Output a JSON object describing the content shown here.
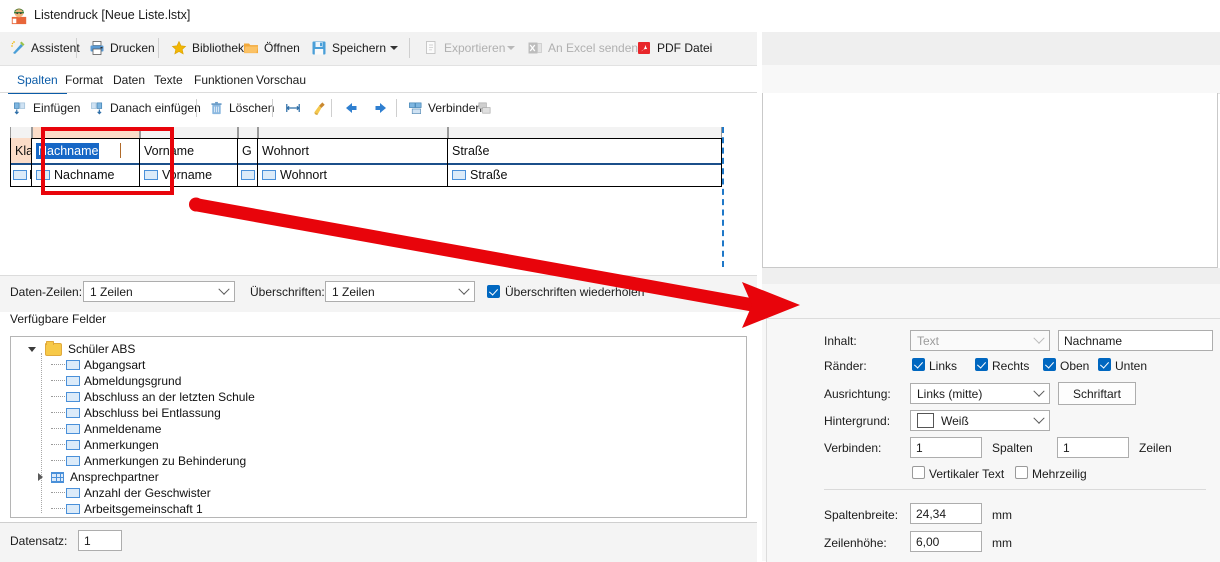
{
  "window": {
    "title": "Listendruck [Neue Liste.lstx]",
    "icon": "app-icon",
    "minimize": "minimize",
    "maximize": "maximize",
    "close": "close"
  },
  "toolbar": {
    "items": [
      {
        "label": "Assistent",
        "icon": "wand-icon",
        "enabled": true
      },
      {
        "label": "Drucken",
        "icon": "printer-icon",
        "enabled": true
      },
      {
        "label": "Bibliothek",
        "icon": "star-icon",
        "enabled": true
      },
      {
        "label": "Öffnen",
        "icon": "folder-open-icon",
        "enabled": true
      },
      {
        "label": "Speichern",
        "icon": "floppy-disk-icon",
        "enabled": true
      },
      {
        "label": "Exportieren",
        "icon": "export-icon",
        "enabled": false
      },
      {
        "label": "An Excel senden",
        "icon": "excel-icon",
        "enabled": false
      },
      {
        "label": "PDF Datei",
        "icon": "pdf-icon",
        "enabled": true
      }
    ]
  },
  "tabs": {
    "items": [
      "Spalten",
      "Format",
      "Daten",
      "Texte",
      "Funktionen",
      "Vorschau"
    ],
    "selected": "Spalten"
  },
  "subtoolbar": {
    "items": [
      {
        "label": "Einfügen",
        "icon": "insert-column-icon"
      },
      {
        "label": "Danach einfügen",
        "icon": "insert-column-after-icon"
      },
      {
        "label": "Löschen",
        "icon": "trash-icon"
      },
      {
        "label": "",
        "icon": "fit-width-icon"
      },
      {
        "label": "",
        "icon": "broom-icon"
      },
      {
        "label": "",
        "icon": "arrow-left-icon"
      },
      {
        "label": "",
        "icon": "arrow-right-icon"
      },
      {
        "label": "Verbinden",
        "icon": "merge-cells-icon"
      },
      {
        "label": "",
        "icon": "split-cells-icon"
      }
    ]
  },
  "grid": {
    "header_row": [
      {
        "text": "Kla...",
        "selected": false
      },
      {
        "text": "Nachname",
        "selected": true
      },
      {
        "text": "Vorname",
        "selected": false
      },
      {
        "text": "G",
        "selected": false
      },
      {
        "text": "Wohnort",
        "selected": false
      },
      {
        "text": "Straße",
        "selected": false
      }
    ],
    "data_row": [
      {
        "text": "K.",
        "chip": true
      },
      {
        "text": "Nachname",
        "chip": true
      },
      {
        "text": "Vorname",
        "chip": true
      },
      {
        "text": "",
        "chip": true
      },
      {
        "text": "Wohnort",
        "chip": true
      },
      {
        "text": "Straße",
        "chip": true
      }
    ]
  },
  "options": {
    "data_rows_label": "Daten-Zeilen:",
    "data_rows_value": "1 Zeilen",
    "headings_label": "Überschriften:",
    "headings_value": "1 Zeilen",
    "repeat_headings_label": "Überschriften wiederholen",
    "repeat_headings_checked": true
  },
  "fields": {
    "label": "Verfügbare Felder",
    "tree": [
      {
        "label": "Schüler ABS",
        "level": 0,
        "icon": "folder-icon",
        "expander": "open"
      },
      {
        "label": "Abgangsart",
        "level": 1,
        "icon": "field-icon",
        "expander": "none"
      },
      {
        "label": "Abmeldungsgrund",
        "level": 1,
        "icon": "field-icon",
        "expander": "none"
      },
      {
        "label": "Abschluss an der letzten Schule",
        "level": 1,
        "icon": "field-icon",
        "expander": "none"
      },
      {
        "label": "Abschluss bei Entlassung",
        "level": 1,
        "icon": "field-icon",
        "expander": "none"
      },
      {
        "label": "Anmeldename",
        "level": 1,
        "icon": "field-icon",
        "expander": "none"
      },
      {
        "label": "Anmerkungen",
        "level": 1,
        "icon": "field-icon",
        "expander": "none"
      },
      {
        "label": "Anmerkungen zu Behinderung",
        "level": 1,
        "icon": "field-icon",
        "expander": "none"
      },
      {
        "label": "Ansprechpartner",
        "level": 1,
        "icon": "table-icon",
        "expander": "closed"
      },
      {
        "label": "Anzahl der Geschwister",
        "level": 1,
        "icon": "field-icon",
        "expander": "none"
      },
      {
        "label": "Arbeitsgemeinschaft 1",
        "level": 1,
        "icon": "field-icon",
        "expander": "none"
      }
    ]
  },
  "record": {
    "label": "Datensatz:",
    "value": "1"
  },
  "properties": {
    "content_label": "Inhalt:",
    "content_type": "Text",
    "content_value": "Nachname",
    "borders_label": "Ränder:",
    "borders": [
      {
        "label": "Links",
        "checked": true
      },
      {
        "label": "Rechts",
        "checked": true
      },
      {
        "label": "Oben",
        "checked": true
      },
      {
        "label": "Unten",
        "checked": true
      }
    ],
    "alignment_label": "Ausrichtung:",
    "alignment_value": "Links (mitte)",
    "font_button": "Schriftart",
    "background_label": "Hintergrund:",
    "background_value": "Weiß",
    "background_color": "#ffffff",
    "merge_label": "Verbinden:",
    "merge_cols_value": "1",
    "merge_cols_unit": "Spalten",
    "merge_rows_value": "1",
    "merge_rows_unit": "Zeilen",
    "vertical_text_label": "Vertikaler Text",
    "vertical_text_checked": false,
    "multiline_label": "Mehrzeilig",
    "multiline_checked": false,
    "column_width_label": "Spaltenbreite:",
    "column_width_value": "24,34",
    "column_width_unit": "mm",
    "row_height_label": "Zeilenhöhe:",
    "row_height_value": "6,00",
    "row_height_unit": "mm"
  },
  "annotations": {
    "highlight_color": "#e8040b",
    "arrow_color": "#e8040b",
    "highlight_target": "Nachname column",
    "arrow_target": "properties panel"
  }
}
